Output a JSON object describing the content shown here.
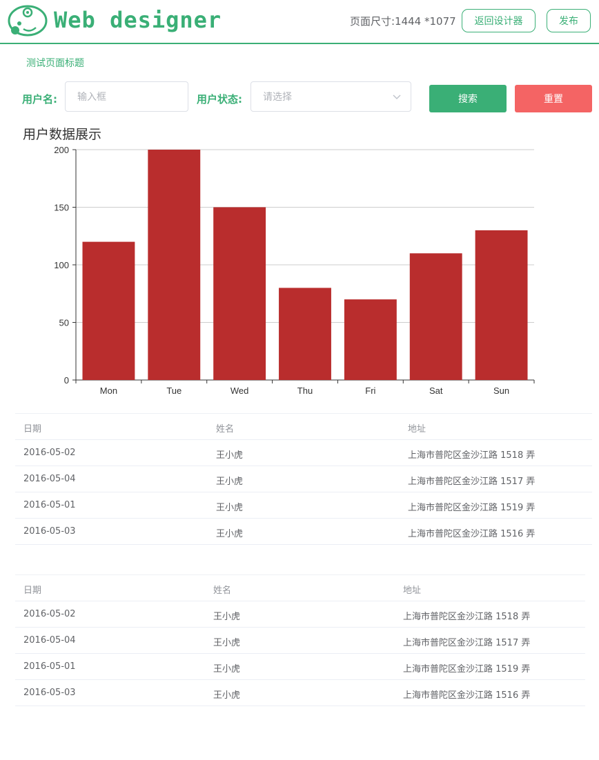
{
  "header": {
    "logo_text": "Web designer",
    "page_size": "页面尺寸:1444 *1077",
    "back_button": "返回设计器",
    "publish_button": "发布",
    "brand_color": "#3aaf76"
  },
  "page": {
    "title": "测试页面标题"
  },
  "form": {
    "username_label": "用户名:",
    "username_placeholder": "输入框",
    "status_label": "用户状态:",
    "status_placeholder": "请选择",
    "search_button": "搜索",
    "reset_button": "重置"
  },
  "chart_data": {
    "type": "bar",
    "title": "用户数据展示",
    "categories": [
      "Mon",
      "Tue",
      "Wed",
      "Thu",
      "Fri",
      "Sat",
      "Sun"
    ],
    "values": [
      120,
      200,
      150,
      80,
      70,
      110,
      130
    ],
    "yticks": [
      "0",
      "50",
      "100",
      "150",
      "200"
    ],
    "ylim": [
      0,
      200
    ],
    "bar_color": "#b92d2d",
    "grid": true
  },
  "table1": {
    "headers": [
      "日期",
      "姓名",
      "地址"
    ],
    "rows": [
      [
        "2016-05-02",
        "王小虎",
        "上海市普陀区金沙江路 1518 弄"
      ],
      [
        "2016-05-04",
        "王小虎",
        "上海市普陀区金沙江路 1517 弄"
      ],
      [
        "2016-05-01",
        "王小虎",
        "上海市普陀区金沙江路 1519 弄"
      ],
      [
        "2016-05-03",
        "王小虎",
        "上海市普陀区金沙江路 1516 弄"
      ]
    ]
  },
  "table2": {
    "headers": [
      "日期",
      "姓名",
      "地址"
    ],
    "rows": [
      [
        "2016-05-02",
        "王小虎",
        "上海市普陀区金沙江路 1518 弄"
      ],
      [
        "2016-05-04",
        "王小虎",
        "上海市普陀区金沙江路 1517 弄"
      ],
      [
        "2016-05-01",
        "王小虎",
        "上海市普陀区金沙江路 1519 弄"
      ],
      [
        "2016-05-03",
        "王小虎",
        "上海市普陀区金沙江路 1516 弄"
      ]
    ]
  }
}
